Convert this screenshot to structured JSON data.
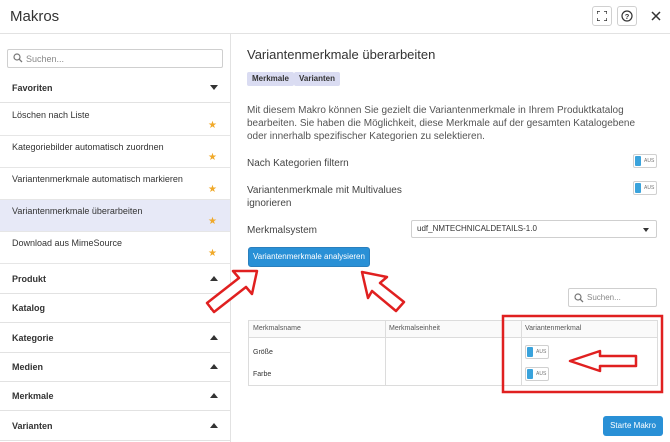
{
  "window": {
    "title": "Makros"
  },
  "sidebar": {
    "search_placeholder": "Suchen...",
    "favorites_header": "Favoriten",
    "favorites": [
      {
        "label": "Löschen nach Liste"
      },
      {
        "label": "Kategoriebilder automatisch zuordnen"
      },
      {
        "label": "Variantenmerkmale automatisch markieren"
      },
      {
        "label": "Variantenmerkmale überarbeiten"
      },
      {
        "label": "Download aus MimeSource"
      }
    ],
    "sections": [
      "Produkt",
      "Katalog",
      "Kategorie",
      "Medien",
      "Merkmale",
      "Varianten"
    ]
  },
  "main": {
    "title": "Variantenmerkmale überarbeiten",
    "tags": [
      "Merkmale",
      "Varianten"
    ],
    "description": "Mit diesem Makro können Sie gezielt die Variantenmerkmale in Ihrem Produktkatalog bearbeiten. Sie haben die Möglichkeit, diese Merkmale auf der gesamten Katalogebene oder innerhalb spezifischer Kategorien zu selektieren.",
    "options": [
      {
        "label": "Nach Kategorien filtern",
        "toggle": "AUS"
      },
      {
        "label": "Variantenmerkmale mit Multivalues ignorieren",
        "toggle": "AUS"
      }
    ],
    "merkmalsystem_label": "Merkmalsystem",
    "merkmalsystem_value": "udf_NMTECHNICALDETAILS-1.0",
    "analyze_button": "Variantenmerkmale analysieren",
    "table_search_placeholder": "Suchen...",
    "table": {
      "headers": [
        "Merkmalsname",
        "Merkmalseinheit",
        "Variantenmerkmal"
      ],
      "rows": [
        {
          "name": "Größe",
          "unit": "",
          "toggle": "AUS"
        },
        {
          "name": "Farbe",
          "unit": "",
          "toggle": "AUS"
        }
      ]
    },
    "start_button": "Starte Makro"
  },
  "colors": {
    "accent": "#2990d6",
    "annotation": "#e02020",
    "star": "#f0a92a",
    "active_item": "#e7e9f7"
  }
}
